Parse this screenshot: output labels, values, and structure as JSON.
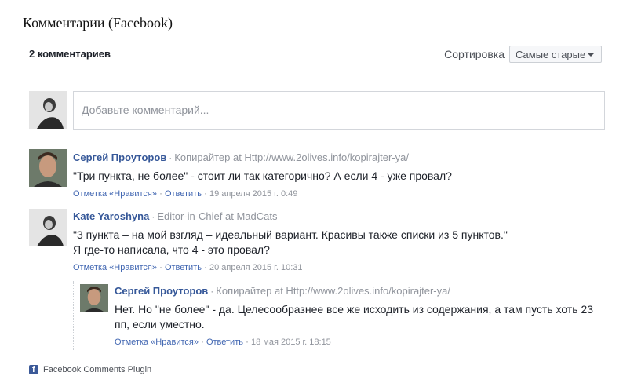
{
  "header": {
    "title": "Комментарии (Facebook)"
  },
  "toolbar": {
    "count_label": "2 комментариев",
    "sort_label": "Сортировка",
    "sort_value": "Самые старые"
  },
  "composer": {
    "placeholder": "Добавьте комментарий..."
  },
  "comments": [
    {
      "author": "Сергей Проуторов",
      "role": "Копирайтер at Http://www.2olives.info/kopirajter-ya/",
      "text_lines": [
        "\"Три пункта, не более\" - стоит ли так категорично? А если 4 - уже провал?"
      ],
      "like": "Отметка «Нравится»",
      "reply": "Ответить",
      "time": "19 апреля 2015 г. 0:49"
    },
    {
      "author": "Kate Yaroshyna",
      "role": "Editor-in-Chief at MadCats",
      "text_lines": [
        "\"3 пункта – на мой взгляд – идеальный вариант. Красивы также списки из 5 пунктов.\"",
        "Я где-то написала, что 4 - это провал?"
      ],
      "like": "Отметка «Нравится»",
      "reply": "Ответить",
      "time": "20 апреля 2015 г. 10:31"
    },
    {
      "author": "Сергей Проуторов",
      "role": "Копирайтер at Http://www.2olives.info/kopirajter-ya/",
      "text_lines": [
        "Нет. Но \"не более\" - да. Целесообразнее все же исходить из содержания, а там пусть хоть 23",
        "пп, если уместно."
      ],
      "like": "Отметка «Нравится»",
      "reply": "Ответить",
      "time": "18 мая 2015 г. 18:15"
    }
  ],
  "footer": {
    "plugin_label": "Facebook Comments Plugin"
  }
}
